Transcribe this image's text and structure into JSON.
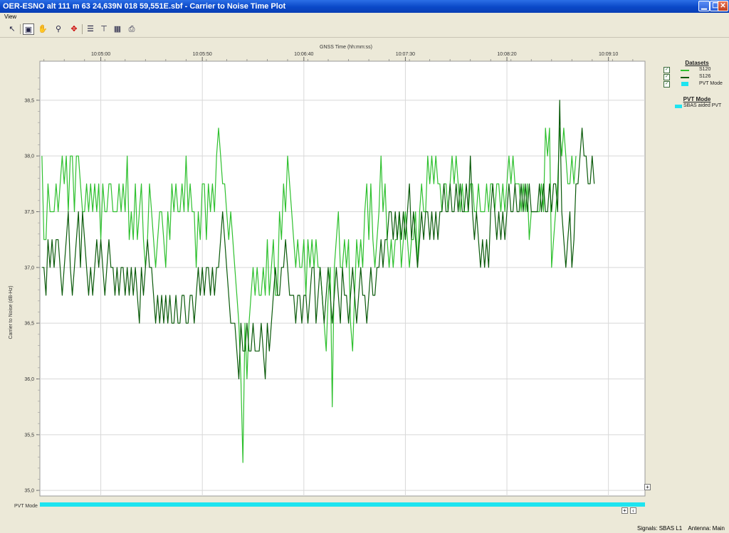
{
  "window": {
    "title": "OER-ESNO alt 111 m 63 24,639N 018 59,551E.sbf - Carrier to Noise Time Plot",
    "menu": [
      "View"
    ],
    "toolbar_icons": [
      "cursor-icon",
      "zoom-box-icon",
      "pan-hand-icon",
      "magnify-icon",
      "fit-extent-icon",
      "horizontal-cursor-icon",
      "vertical-cursor-icon",
      "statistics-icon",
      "print-icon"
    ]
  },
  "legend": {
    "title": "Datasets",
    "items": [
      {
        "label": "S120",
        "color": "#2ec02e"
      },
      {
        "label": "S126",
        "color": "#0a5a0a"
      },
      {
        "label": "PVT Mode",
        "color": "#1ee4f0"
      }
    ]
  },
  "pvt_legend": {
    "title": "PVT Mode",
    "items": [
      {
        "label": "SBAS aided PVT",
        "color": "#1ee4f0"
      }
    ]
  },
  "status": {
    "signals": "Signals: SBAS L1",
    "antenna": "Antenna: Main"
  },
  "chart_data": {
    "type": "line",
    "xlabel": "GNSS Time (hh:mm:ss)",
    "ylabel": "Carrier to Noise (dB-Hz)",
    "x_ticks": [
      "10:05:00",
      "10:05:50",
      "10:06:40",
      "10:07:30",
      "10:08:20",
      "10:09:10"
    ],
    "x_tick_seconds": [
      300,
      350,
      400,
      450,
      500,
      550
    ],
    "xlim": [
      270,
      568
    ],
    "y_ticks": [
      "35,0",
      "35,5",
      "36,0",
      "36,5",
      "37,0",
      "37,5",
      "38,0",
      "38,5"
    ],
    "ylim": [
      34.95,
      38.85
    ],
    "grid": true,
    "pvt_lane_label": "PVT Mode",
    "series": [
      {
        "name": "S120",
        "color": "#2ec02e",
        "x_start": 271,
        "x_step": 1,
        "values": [
          38.0,
          37.25,
          37.25,
          37.75,
          37.5,
          37.5,
          37.5,
          37.75,
          37.5,
          37.75,
          38.0,
          37.75,
          38.0,
          37.5,
          38.0,
          38.0,
          37.5,
          38.0,
          38.0,
          37.75,
          37.5,
          37.5,
          37.75,
          37.5,
          37.75,
          37.5,
          37.75,
          37.5,
          37.75,
          37.25,
          37.75,
          37.5,
          37.5,
          37.75,
          37.75,
          37.5,
          37.5,
          37.5,
          37.75,
          37.5,
          37.75,
          37.5,
          38.0,
          37.25,
          37.5,
          37.25,
          37.75,
          37.25,
          37.5,
          37.75,
          37.25,
          37.0,
          37.25,
          37.75,
          37.5,
          37.25,
          37.0,
          37.25,
          37.5,
          37.5,
          37.25,
          37.0,
          37.5,
          37.25,
          37.75,
          37.5,
          37.75,
          37.5,
          37.5,
          37.75,
          37.5,
          38.0,
          37.5,
          37.75,
          37.5,
          37.5,
          37.0,
          37.5,
          37.25,
          37.75,
          37.75,
          37.25,
          37.75,
          37.5,
          37.75,
          37.5,
          38.0,
          38.25,
          38.0,
          37.75,
          37.75,
          37.5,
          37.25,
          37.5,
          37.25,
          37.0,
          36.75,
          36.5,
          36.0,
          35.25,
          36.5,
          36.0,
          36.5,
          36.75,
          37.0,
          36.75,
          37.0,
          36.75,
          36.75,
          37.0,
          36.75,
          37.25,
          36.75,
          37.0,
          37.25,
          36.75,
          36.75,
          37.5,
          37.25,
          37.75,
          37.5,
          38.0,
          37.75,
          37.5,
          37.25,
          37.0,
          37.25,
          37.0,
          37.0,
          37.25,
          36.75,
          37.25,
          37.0,
          37.25,
          37.0,
          37.25,
          37.0,
          37.0,
          36.75,
          36.5,
          36.25,
          36.75,
          37.0,
          35.75,
          37.0,
          37.25,
          37.5,
          37.0,
          37.0,
          37.25,
          37.0,
          37.25,
          36.5,
          36.25,
          36.75,
          37.25,
          37.0,
          37.25,
          37.0,
          37.5,
          37.75,
          37.25,
          37.75,
          37.25,
          37.0,
          37.25,
          37.5,
          38.0,
          37.5,
          37.75,
          37.25,
          37.0,
          37.25,
          37.0,
          37.25,
          37.25,
          37.5,
          37.0,
          37.25,
          37.5,
          37.25,
          37.0,
          37.25,
          37.25,
          37.5,
          37.0,
          37.5,
          37.75,
          37.5,
          37.5,
          38.0,
          37.75,
          38.0,
          37.75,
          38.0,
          37.75,
          37.75,
          37.5,
          37.75,
          37.75,
          37.5,
          37.75,
          38.0,
          37.75,
          38.0,
          37.75,
          37.5,
          37.75,
          37.5,
          37.5,
          37.5,
          37.75,
          37.75,
          37.5,
          37.5,
          37.75,
          37.5,
          37.5,
          37.5,
          37.75,
          37.5,
          37.75,
          37.75,
          37.5,
          37.75,
          37.75,
          37.5,
          37.75,
          37.5,
          37.75,
          38.0,
          37.75,
          38.0,
          37.75,
          37.75,
          37.75,
          37.5,
          37.75,
          37.5,
          37.75,
          37.25,
          37.5,
          37.5,
          37.5,
          37.5,
          37.5,
          37.75,
          37.5,
          38.25,
          38.0,
          38.25,
          37.0,
          37.25,
          37.5,
          37.75,
          38.25,
          38.0,
          38.25,
          38.0,
          37.75,
          37.75,
          38.0,
          37.75,
          38.0
        ]
      },
      {
        "name": "S126",
        "color": "#0a5a0a",
        "x_start": 271,
        "x_step": 1,
        "values": [
          37.0,
          37.0,
          36.75,
          37.25,
          37.0,
          37.25,
          37.0,
          37.25,
          37.25,
          37.0,
          36.75,
          37.0,
          37.25,
          37.5,
          37.0,
          36.75,
          37.0,
          37.25,
          37.5,
          37.0,
          37.5,
          37.25,
          37.0,
          36.75,
          37.0,
          36.75,
          37.0,
          37.25,
          37.0,
          37.25,
          37.0,
          36.75,
          37.0,
          37.25,
          37.0,
          37.0,
          36.75,
          37.0,
          36.75,
          37.0,
          37.0,
          36.75,
          37.0,
          36.75,
          37.0,
          36.75,
          37.0,
          36.75,
          36.5,
          37.0,
          36.75,
          37.0,
          37.25,
          37.0,
          37.0,
          36.75,
          36.5,
          36.75,
          36.5,
          36.75,
          36.5,
          36.75,
          36.5,
          36.75,
          36.5,
          36.5,
          36.75,
          36.5,
          36.5,
          36.75,
          36.75,
          36.5,
          36.5,
          36.75,
          36.75,
          36.5,
          36.75,
          37.0,
          36.75,
          37.0,
          36.75,
          37.0,
          37.0,
          36.75,
          37.0,
          36.75,
          37.0,
          37.0,
          37.25,
          37.5,
          37.25,
          37.0,
          36.75,
          36.5,
          36.5,
          36.5,
          36.25,
          36.0,
          36.5,
          36.25,
          36.25,
          36.5,
          36.25,
          36.25,
          36.5,
          36.25,
          36.25,
          36.25,
          36.5,
          36.25,
          36.0,
          36.5,
          36.25,
          36.5,
          36.75,
          37.0,
          36.75,
          36.75,
          37.0,
          37.0,
          37.25,
          37.0,
          36.75,
          36.75,
          36.75,
          36.5,
          36.75,
          36.75,
          36.5,
          36.75,
          36.75,
          36.5,
          36.75,
          37.0,
          37.0,
          36.5,
          36.75,
          37.0,
          36.75,
          36.5,
          36.75,
          37.0,
          36.75,
          36.5,
          36.75,
          37.0,
          36.75,
          36.5,
          37.0,
          36.75,
          36.75,
          36.5,
          36.75,
          37.0,
          36.75,
          36.5,
          36.75,
          37.0,
          36.75,
          36.75,
          36.5,
          36.75,
          37.0,
          36.75,
          36.75,
          37.0,
          37.0,
          37.25,
          37.0,
          37.25,
          37.25,
          37.5,
          37.5,
          37.25,
          37.5,
          37.25,
          37.5,
          37.25,
          37.5,
          37.25,
          37.5,
          37.75,
          37.25,
          37.5,
          37.25,
          37.0,
          37.25,
          37.5,
          37.25,
          37.5,
          37.5,
          37.25,
          37.5,
          37.25,
          37.5,
          37.25,
          37.5,
          37.5,
          37.75,
          37.5,
          37.5,
          37.75,
          37.5,
          37.5,
          37.75,
          37.5,
          37.75,
          37.5,
          37.5,
          37.75,
          37.5,
          38.0,
          37.5,
          37.25,
          37.5,
          37.25,
          37.0,
          37.25,
          37.0,
          37.25,
          37.0,
          37.5,
          37.75,
          37.5,
          37.25,
          37.5,
          37.25,
          37.5,
          37.25,
          37.5,
          37.75,
          37.5,
          37.5,
          37.75,
          37.5,
          37.5,
          37.75,
          37.5,
          37.75,
          37.5,
          37.75,
          37.5,
          37.5,
          37.5,
          37.5,
          37.75,
          37.5,
          37.75,
          37.5,
          37.5,
          37.75,
          37.5,
          37.75,
          37.75,
          37.5,
          38.5,
          37.5,
          37.25,
          37.0,
          37.25,
          37.5,
          37.0,
          37.25,
          37.75,
          37.75,
          38.0,
          38.25,
          38.0,
          38.0,
          37.75,
          37.75,
          38.0,
          37.75
        ]
      }
    ]
  }
}
